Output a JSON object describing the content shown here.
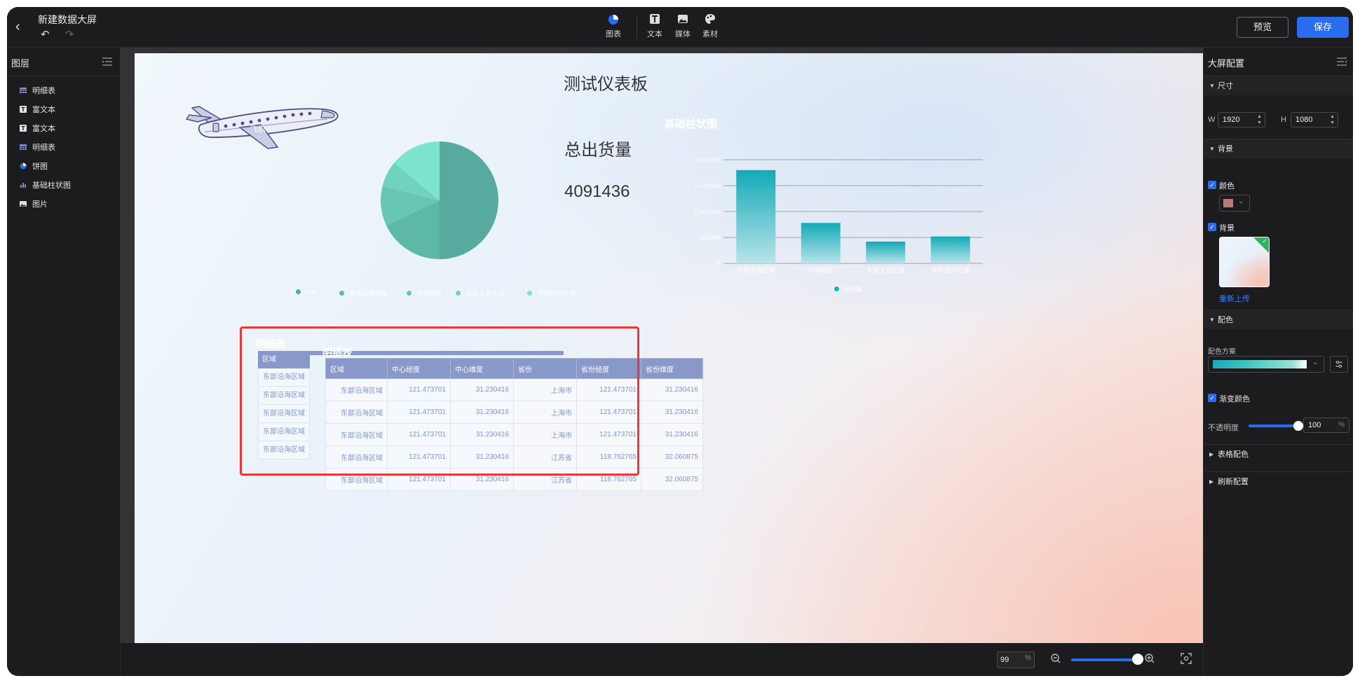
{
  "header": {
    "title": "新建数据大屏",
    "tools": [
      {
        "label": "图表",
        "icon": "pie-chart-icon"
      },
      {
        "label": "文本",
        "icon": "text-icon"
      },
      {
        "label": "媒体",
        "icon": "image-icon"
      },
      {
        "label": "素材",
        "icon": "palette-icon"
      }
    ],
    "preview_label": "预览",
    "save_label": "保存"
  },
  "layers": {
    "title": "图层",
    "items": [
      {
        "label": "明细表",
        "icon": "table-icon"
      },
      {
        "label": "富文本",
        "icon": "text-icon"
      },
      {
        "label": "富文本",
        "icon": "text-icon"
      },
      {
        "label": "明细表",
        "icon": "table-icon"
      },
      {
        "label": "饼图",
        "icon": "pie-chart-icon"
      },
      {
        "label": "基础柱状图",
        "icon": "bar-chart-icon"
      },
      {
        "label": "图片",
        "icon": "image-icon"
      }
    ]
  },
  "canvas": {
    "title": "测试仪表板",
    "airplane_label": "飞机",
    "kpi_label": "总出货量",
    "kpi_value": "4091436",
    "bar_title": "基础柱状图",
    "ghost_table_title": "明细表",
    "main_table_title": "明细表"
  },
  "chart_data": [
    {
      "type": "pie",
      "categories": [
        "null",
        "东部沿海区域",
        "中部地区",
        "北部工业区域",
        "华南经济区域"
      ],
      "values": [
        50,
        18,
        11,
        7,
        14
      ],
      "colors": [
        "#56ab9e",
        "#5db8a6",
        "#67c7b2",
        "#6fd3bd",
        "#7ee3cd"
      ]
    },
    {
      "type": "bar",
      "title": "基础柱状图",
      "categories": [
        "东部沿海区域",
        "中部地区",
        "北部工业区域",
        "华南经济区域"
      ],
      "series": [
        {
          "name": "出货量",
          "values": [
            1800000,
            780000,
            420000,
            520000
          ]
        }
      ],
      "ylim": [
        0,
        2000000
      ],
      "yticks": [
        "0",
        "500,000",
        "1,000,000",
        "1,500,000",
        "2,000,000"
      ],
      "grid": true
    }
  ],
  "ghost_table": {
    "header": "区域",
    "rows": [
      "东部沿海区域",
      "东部沿海区域",
      "东部沿海区域",
      "东部沿海区域",
      "东部沿海区域"
    ]
  },
  "main_table": {
    "columns": [
      "区域",
      "中心经度",
      "中心维度",
      "省份",
      "省份经度",
      "省份维度"
    ],
    "rows": [
      [
        "东部沿海区域",
        "121.473701",
        "31.230416",
        "上海市",
        "121.473701",
        "31.230416"
      ],
      [
        "东部沿海区域",
        "121.473701",
        "31.230416",
        "上海市",
        "121.473701",
        "31.230416"
      ],
      [
        "东部沿海区域",
        "121.473701",
        "31.230416",
        "上海市",
        "121.473701",
        "31.230416"
      ],
      [
        "东部沿海区域",
        "121.473701",
        "31.230416",
        "江苏省",
        "118.762765",
        "32.060875"
      ],
      [
        "东部沿海区域",
        "121.473701",
        "31.230416",
        "江苏省",
        "118.762765",
        "32.060875"
      ]
    ]
  },
  "bottom": {
    "zoom": "99",
    "zoom_unit": "%",
    "zoom_level": 0.99
  },
  "config": {
    "title": "大屏配置",
    "size_section": "尺寸",
    "w_label": "W",
    "w_value": "1920",
    "h_label": "H",
    "h_value": "1080",
    "bg_section": "背景",
    "color_label": "颜色",
    "color_value": "#b87a7a",
    "bg_label": "背景",
    "reupload_label": "重新上传",
    "palette_section": "配色",
    "scheme_label": "配色方案",
    "gradient_label": "渐变颜色",
    "opacity_label": "不透明度",
    "opacity_value": "100",
    "opacity_unit": "%",
    "table_color_section": "表格配色",
    "refresh_section": "刷新配置"
  },
  "colors": {
    "accent": "#2a6cf0",
    "selection": "#e5393c",
    "bar": "#1ab0bd"
  }
}
